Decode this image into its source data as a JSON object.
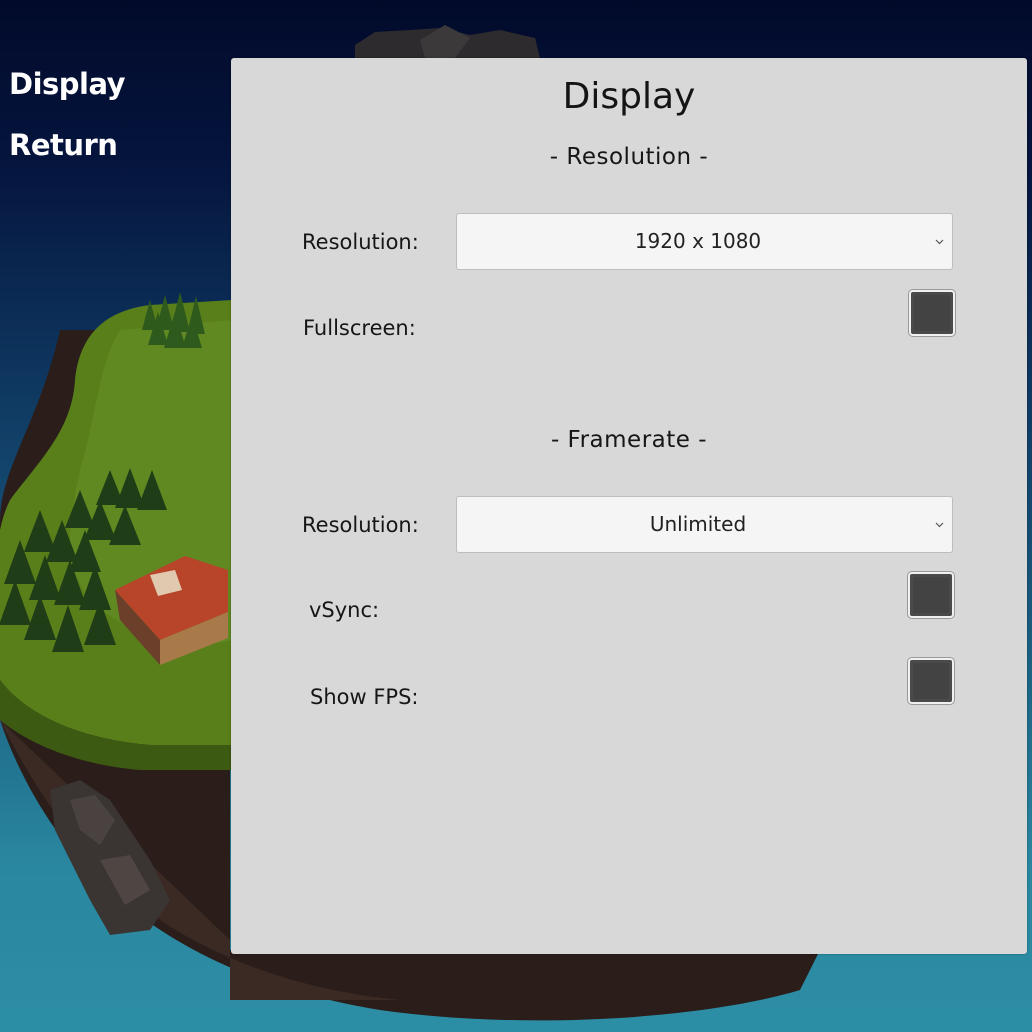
{
  "side_menu": {
    "items": [
      {
        "label": "Display"
      },
      {
        "label": "Return"
      }
    ]
  },
  "panel": {
    "title": "Display",
    "resolution_section": {
      "header": "- Resolution -",
      "resolution_label": "Resolution:",
      "resolution_value": "1920 x 1080",
      "fullscreen_label": "Fullscreen:",
      "fullscreen_checked": false
    },
    "framerate_section": {
      "header": "- Framerate -",
      "framerate_label": "Resolution:",
      "framerate_value": "Unlimited",
      "vsync_label": "vSync:",
      "vsync_checked": false,
      "show_fps_label": "Show FPS:",
      "show_fps_checked": false
    }
  },
  "colors": {
    "panel_background": "#d8d8d8",
    "dropdown_background": "#f5f5f5",
    "toggle_off": "#434343",
    "menu_text": "#ffffff"
  },
  "icons": {
    "dropdown_arrow": "chevron-down-icon"
  }
}
